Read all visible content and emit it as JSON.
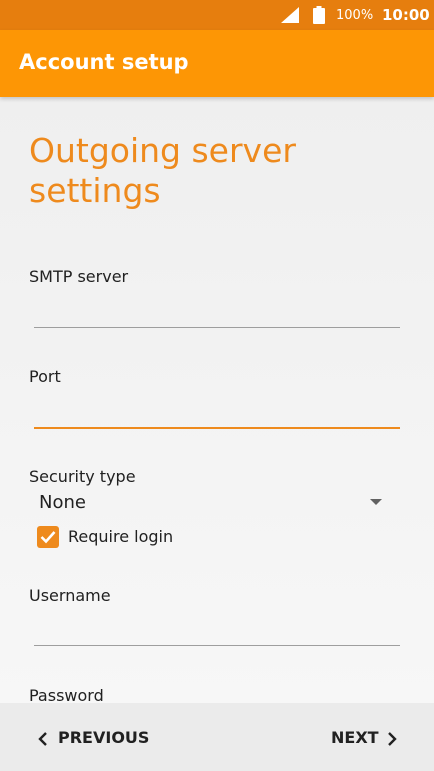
{
  "status_bar": {
    "icons": [
      "signal-icon",
      "battery-icon"
    ],
    "battery": "100%",
    "time": "10:00"
  },
  "app_bar": {
    "title": "Account setup"
  },
  "form": {
    "heading": "Outgoing server settings",
    "smtp_server": {
      "label": "SMTP server",
      "value": ""
    },
    "port": {
      "label": "Port",
      "value": ""
    },
    "security_type": {
      "label": "Security type",
      "value": "None"
    },
    "require_login": {
      "label": "Require login",
      "checked": true
    },
    "username": {
      "label": "Username",
      "value": ""
    },
    "password": {
      "label": "Password",
      "value": ""
    }
  },
  "navigation": {
    "previous": "PREVIOUS",
    "next": "NEXT"
  },
  "colors": {
    "status_bar": "#e67e0e",
    "app_bar": "#fd9605",
    "accent": "#ee8a1d"
  }
}
